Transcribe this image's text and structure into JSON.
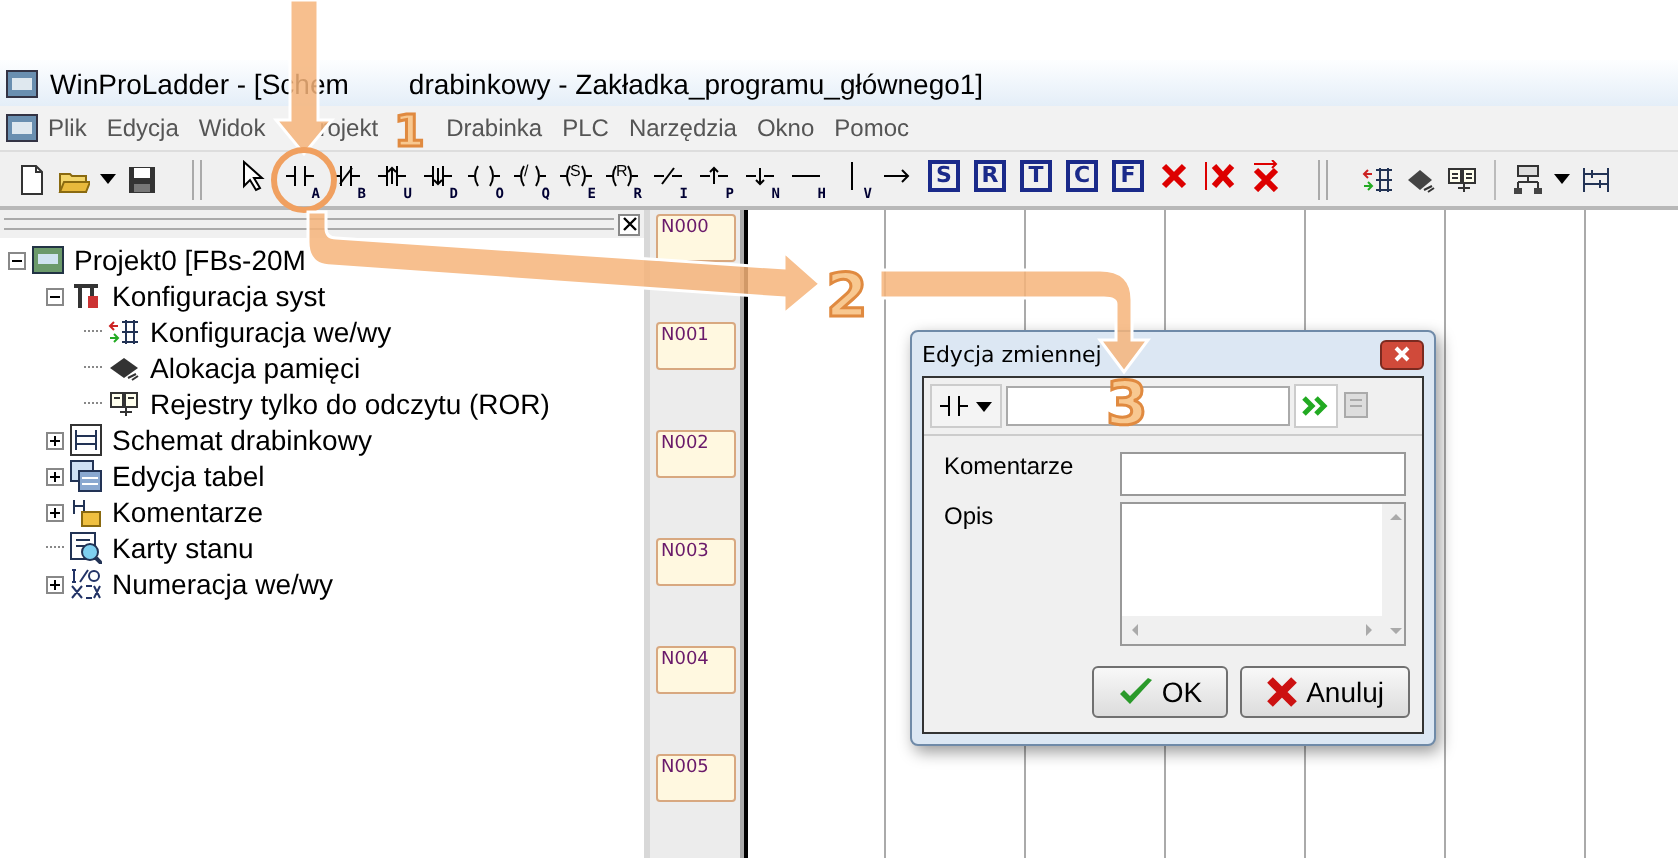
{
  "window": {
    "title_parts": [
      "WinProLadder - [Schem",
      "drabinkowy - Zakładka_programu_głównego1]"
    ]
  },
  "menu": [
    "Plik",
    "Edycja",
    "Widok",
    "rojekt",
    "Drabinka",
    "PLC",
    "Narzędzia",
    "Okno",
    "Pomoc"
  ],
  "toolbar": {
    "file_tools": [
      {
        "kind": "new"
      },
      {
        "kind": "open"
      },
      {
        "kind": "dropdown"
      },
      {
        "kind": "save"
      }
    ],
    "ladder_tools": [
      {
        "kind": "pointer"
      },
      {
        "kind": "contact",
        "letter": "A"
      },
      {
        "kind": "contact-nc",
        "letter": "B"
      },
      {
        "kind": "contact-up",
        "letter": "U"
      },
      {
        "kind": "contact-down",
        "letter": "D"
      },
      {
        "kind": "coil",
        "letter": "O"
      },
      {
        "kind": "coil",
        "inner": "/",
        "letter": "Q"
      },
      {
        "kind": "coil",
        "inner": "S",
        "letter": "E"
      },
      {
        "kind": "coil",
        "inner": "R",
        "letter": "R"
      },
      {
        "kind": "line-nc",
        "letter": "I"
      },
      {
        "kind": "line-up",
        "letter": "P"
      },
      {
        "kind": "line-down",
        "letter": "N"
      },
      {
        "kind": "line",
        "letter": "H"
      },
      {
        "kind": "vline",
        "letter": "V"
      },
      {
        "kind": "arrow"
      },
      {
        "kind": "boxed",
        "letter": "S"
      },
      {
        "kind": "boxed",
        "letter": "R"
      },
      {
        "kind": "boxed",
        "letter": "T"
      },
      {
        "kind": "boxed",
        "letter": "C"
      },
      {
        "kind": "boxed",
        "letter": "F"
      },
      {
        "kind": "delete"
      },
      {
        "kind": "delete-column"
      },
      {
        "kind": "delete-row"
      }
    ],
    "right_tools": [
      {
        "kind": "io"
      },
      {
        "kind": "chip"
      },
      {
        "kind": "book"
      },
      {
        "kind": "tree"
      },
      {
        "kind": "dropdown"
      },
      {
        "kind": "ladder"
      }
    ]
  },
  "tree": [
    {
      "label": "Projekt0 [FBs-20M",
      "expanded": true,
      "children": [
        {
          "label": "Konfiguracja syst",
          "expanded": true,
          "children": [
            {
              "label": "Konfiguracja we/wy"
            },
            {
              "label": "Alokacja pamięci"
            },
            {
              "label": "Rejestry tylko do odczytu (ROR)"
            }
          ]
        },
        {
          "label": "Schemat drabinkowy",
          "expanded": false
        },
        {
          "label": "Edycja tabel",
          "expanded": false
        },
        {
          "label": "Komentarze",
          "expanded": false
        },
        {
          "label": "Karty stanu"
        },
        {
          "label": "Numeracja we/wy",
          "expanded": false
        }
      ]
    }
  ],
  "rungs": [
    "N000",
    "N001",
    "N002",
    "N003",
    "N004",
    "N005"
  ],
  "dialog": {
    "title": "Edycja zmiennej",
    "fields": [
      {
        "kind": "line",
        "label": "Komentarze"
      },
      {
        "kind": "area",
        "label": "Opis"
      }
    ],
    "buttons": [
      {
        "kind": "ok",
        "label": "OK"
      },
      {
        "kind": "cancel",
        "label": "Anuluj"
      }
    ]
  },
  "annotations": [
    {
      "label": "1"
    },
    {
      "label": "2"
    },
    {
      "label": "3"
    }
  ]
}
